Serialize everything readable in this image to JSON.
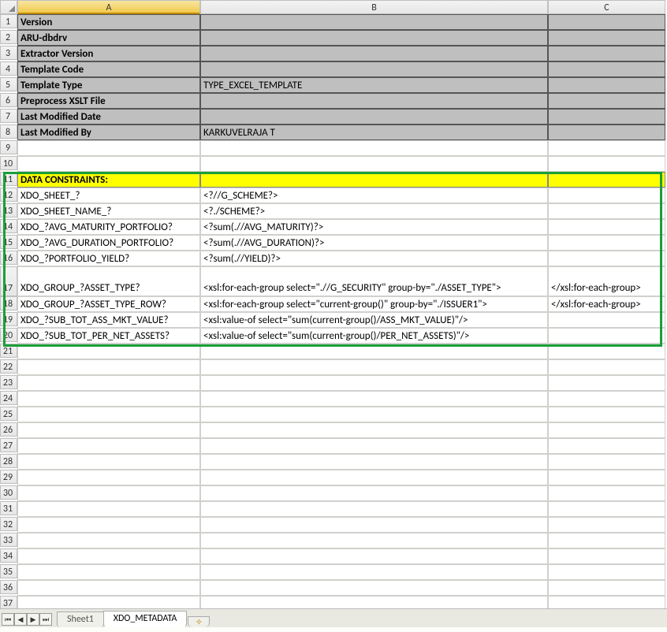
{
  "columns": [
    "A",
    "B",
    "C"
  ],
  "rows": [
    {
      "n": 1,
      "a": "Version",
      "b": "",
      "c": "",
      "cls": "gray"
    },
    {
      "n": 2,
      "a": "ARU-dbdrv",
      "b": "",
      "c": "",
      "cls": "gray"
    },
    {
      "n": 3,
      "a": "Extractor Version",
      "b": "",
      "c": "",
      "cls": "gray"
    },
    {
      "n": 4,
      "a": "Template Code",
      "b": "",
      "c": "",
      "cls": "gray"
    },
    {
      "n": 5,
      "a": "Template Type",
      "b": "TYPE_EXCEL_TEMPLATE",
      "c": "",
      "cls": "gray"
    },
    {
      "n": 6,
      "a": "Preprocess XSLT File",
      "b": "",
      "c": "",
      "cls": "gray"
    },
    {
      "n": 7,
      "a": "Last Modified Date",
      "b": "",
      "c": "",
      "cls": "gray"
    },
    {
      "n": 8,
      "a": "Last Modified By",
      "b": "KARKUVELRAJA T",
      "c": "",
      "cls": "gray"
    },
    {
      "n": 9,
      "a": "",
      "b": "",
      "c": "",
      "cls": ""
    },
    {
      "n": 10,
      "a": "",
      "b": "",
      "c": "",
      "cls": ""
    },
    {
      "n": 11,
      "a": "DATA CONSTRAINTS:",
      "b": "",
      "c": "",
      "cls": "yellow"
    },
    {
      "n": 12,
      "a": "XDO_SHEET_?",
      "b": "<?//G_SCHEME?>",
      "c": "",
      "cls": ""
    },
    {
      "n": 13,
      "a": "XDO_SHEET_NAME_?",
      "b": "<?./SCHEME?>",
      "c": "",
      "cls": ""
    },
    {
      "n": 14,
      "a": "XDO_?AVG_MATURITY_PORTFOLIO?",
      "b": "<?sum(.//AVG_MATURITY)?>",
      "c": "",
      "cls": ""
    },
    {
      "n": 15,
      "a": "XDO_?AVG_DURATION_PORTFOLIO?",
      "b": "<?sum(.//AVG_DURATION)?>",
      "c": "",
      "cls": ""
    },
    {
      "n": 16,
      "a": "XDO_?PORTFOLIO_YIELD?",
      "b": "<?sum(.//YIELD)?>",
      "c": "",
      "cls": ""
    },
    {
      "n": 17,
      "a": "XDO_GROUP_?ASSET_TYPE?",
      "b": "<xsl:for-each-group select=\".//G_SECURITY\" group-by=\"./ASSET_TYPE\">",
      "c": "</xsl:for-each-group>",
      "cls": "",
      "tall": true
    },
    {
      "n": 18,
      "a": "XDO_GROUP_?ASSET_TYPE_ROW?",
      "b": "<xsl:for-each-group select=\"current-group()\" group-by=\"./ISSUER1\">",
      "c": "</xsl:for-each-group>",
      "cls": ""
    },
    {
      "n": 19,
      "a": "XDO_?SUB_TOT_ASS_MKT_VALUE?",
      "b": "<xsl:value-of select=\"sum(current-group()/ASS_MKT_VALUE)\"/>",
      "c": "",
      "cls": ""
    },
    {
      "n": 20,
      "a": "XDO_?SUB_TOT_PER_NET_ASSETS?",
      "b": "<xsl:value-of select=\"sum(current-group()/PER_NET_ASSETS)\"/>",
      "c": "",
      "cls": ""
    },
    {
      "n": 21,
      "a": "",
      "b": "",
      "c": "",
      "cls": ""
    },
    {
      "n": 22,
      "a": "",
      "b": "",
      "c": "",
      "cls": ""
    },
    {
      "n": 23,
      "a": "",
      "b": "",
      "c": "",
      "cls": ""
    },
    {
      "n": 24,
      "a": "",
      "b": "",
      "c": "",
      "cls": ""
    },
    {
      "n": 25,
      "a": "",
      "b": "",
      "c": "",
      "cls": ""
    },
    {
      "n": 26,
      "a": "",
      "b": "",
      "c": "",
      "cls": ""
    },
    {
      "n": 27,
      "a": "",
      "b": "",
      "c": "",
      "cls": ""
    },
    {
      "n": 28,
      "a": "",
      "b": "",
      "c": "",
      "cls": ""
    },
    {
      "n": 29,
      "a": "",
      "b": "",
      "c": "",
      "cls": ""
    },
    {
      "n": 30,
      "a": "",
      "b": "",
      "c": "",
      "cls": ""
    },
    {
      "n": 31,
      "a": "",
      "b": "",
      "c": "",
      "cls": ""
    },
    {
      "n": 32,
      "a": "",
      "b": "",
      "c": "",
      "cls": ""
    },
    {
      "n": 33,
      "a": "",
      "b": "",
      "c": "",
      "cls": ""
    },
    {
      "n": 34,
      "a": "",
      "b": "",
      "c": "",
      "cls": ""
    },
    {
      "n": 35,
      "a": "",
      "b": "",
      "c": "",
      "cls": ""
    },
    {
      "n": 36,
      "a": "",
      "b": "",
      "c": "",
      "cls": ""
    },
    {
      "n": 37,
      "a": "",
      "b": "",
      "c": "",
      "cls": ""
    }
  ],
  "tabs": {
    "nav": [
      "⏮",
      "◀",
      "▶",
      "⏭"
    ],
    "sheet1": "Sheet1",
    "active": "XDO_METADATA",
    "newicon": "✧"
  }
}
